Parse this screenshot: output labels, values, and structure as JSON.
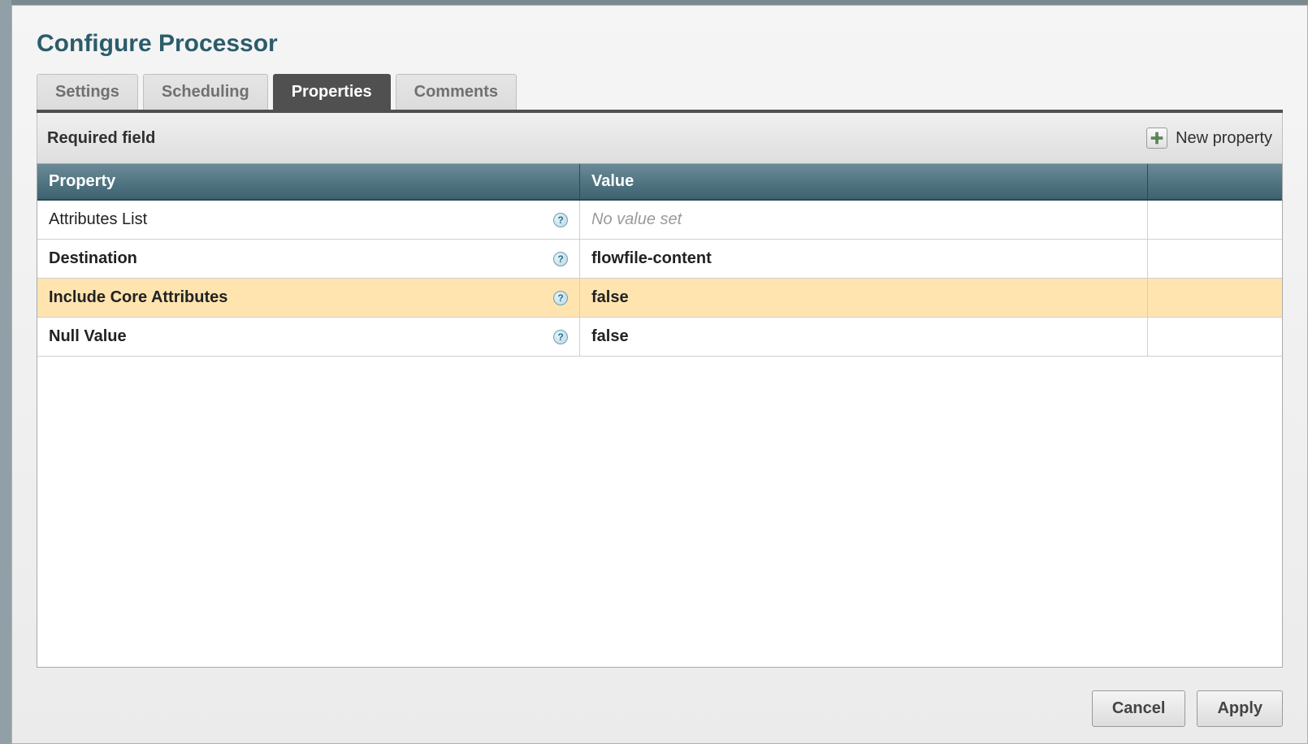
{
  "dialog": {
    "title": "Configure Processor"
  },
  "tabs": {
    "settings": "Settings",
    "scheduling": "Scheduling",
    "properties": "Properties",
    "comments": "Comments",
    "active": "properties"
  },
  "toolbar": {
    "required_label": "Required field",
    "new_property_label": "New property"
  },
  "table": {
    "headers": {
      "property": "Property",
      "value": "Value"
    },
    "no_value_text": "No value set",
    "rows": [
      {
        "name": "Attributes List",
        "required": false,
        "value": null,
        "highlight": false
      },
      {
        "name": "Destination",
        "required": true,
        "value": "flowfile-content",
        "highlight": false
      },
      {
        "name": "Include Core Attributes",
        "required": true,
        "value": "false",
        "highlight": true
      },
      {
        "name": "Null Value",
        "required": true,
        "value": "false",
        "highlight": false
      }
    ]
  },
  "buttons": {
    "cancel": "Cancel",
    "apply": "Apply"
  }
}
